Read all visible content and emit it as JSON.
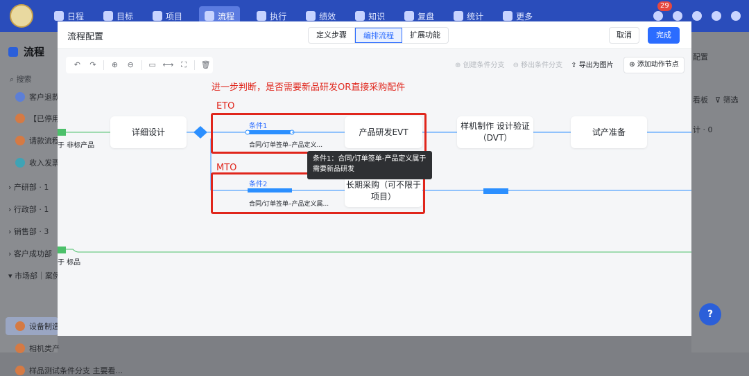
{
  "topnav": {
    "items": [
      {
        "label": "日程",
        "icon": "calendar-icon"
      },
      {
        "label": "目标",
        "icon": "target-icon"
      },
      {
        "label": "项目",
        "icon": "cube-icon"
      },
      {
        "label": "流程",
        "icon": "flow-icon",
        "active": true
      },
      {
        "label": "执行",
        "icon": "list-icon"
      },
      {
        "label": "绩效",
        "icon": "chart-icon"
      },
      {
        "label": "知识",
        "icon": "book-icon"
      },
      {
        "label": "复盘",
        "icon": "review-icon"
      },
      {
        "label": "统计",
        "icon": "pie-icon"
      },
      {
        "label": "更多",
        "icon": "grid-icon"
      }
    ],
    "notification_count": "29"
  },
  "sidebar": {
    "title": "流程",
    "search_placeholder": "搜索",
    "items": [
      {
        "label": "客户退款"
      },
      {
        "label": "【已停用"
      },
      {
        "label": "请款流程"
      },
      {
        "label": "收入发票"
      }
    ],
    "groups": [
      {
        "label": "产研部 · 1"
      },
      {
        "label": "行政部 · 1"
      },
      {
        "label": "销售部 · 3"
      },
      {
        "label": "客户成功部"
      },
      {
        "label": "市场部｜案例"
      }
    ],
    "sub_items": [
      {
        "label": "设备制造"
      },
      {
        "label": "相机类产"
      },
      {
        "label": "样品测试条件分支 主要看..."
      }
    ]
  },
  "rightbg": {
    "config": "配置",
    "board": "看板",
    "filter": "筛选",
    "count": "计 · 0"
  },
  "modal": {
    "title": "流程配置",
    "tabs": [
      {
        "label": "定义步骤"
      },
      {
        "label": "编排流程",
        "active": true
      },
      {
        "label": "扩展功能"
      }
    ],
    "cancel": "取消",
    "done": "完成",
    "tools": {
      "create_branch": "创建条件分支",
      "remove_branch": "移出条件分支",
      "export_image": "导出为图片",
      "add_action_node": "添加动作节点"
    }
  },
  "canvas": {
    "annotation_main": "进一步判断，是否需要新品研发OR直接采购配件",
    "annotation_eto": "ETO",
    "annotation_mto": "MTO",
    "nodes": {
      "detail_design": "详细设计",
      "product_evt": "产品研发EVT",
      "sample_dvt": "样机制作 设计验证（DVT）",
      "trial_prep": "试产准备",
      "long_purchase": "长期采购（可不限于项目）"
    },
    "cond1_label": "条件1",
    "cond1_desc": "合同/订单签单–产品定义...",
    "cond2_label": "条件2",
    "cond2_desc": "合同/订单签单–产品定义属...",
    "tooltip": "条件1：合同/订单签单-产品定义属于 需要新品研发",
    "side_non_product": "于 非标产品",
    "side_standard": "于 标品"
  }
}
